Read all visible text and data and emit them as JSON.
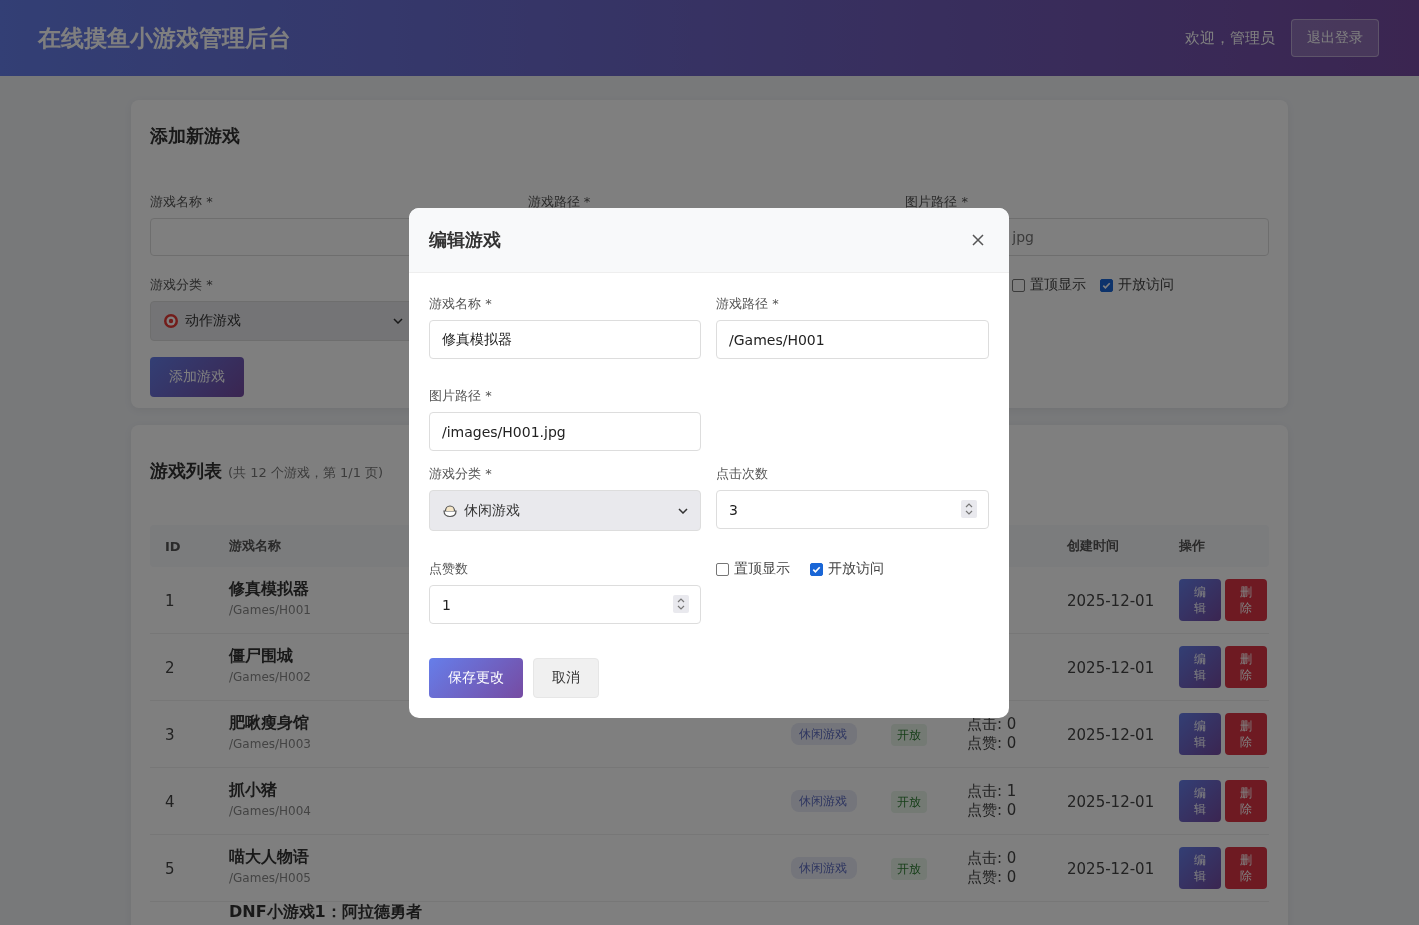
{
  "header": {
    "title": "在线摸鱼小游戏管理后台",
    "welcome": "欢迎，管理员",
    "logout": "退出登录"
  },
  "add_form": {
    "title": "添加新游戏",
    "fields": [
      {
        "label": "游戏名称 *",
        "input": true
      },
      {
        "label": "游戏路径 *",
        "input": false
      },
      {
        "label": "图片路径 *",
        "input": true,
        "placeholder": "jpg"
      }
    ],
    "category": {
      "label": "游戏分类 *",
      "value": "动作游戏"
    },
    "checkboxes": [
      {
        "label": "置顶显示",
        "checked": false
      },
      {
        "label": "开放访问",
        "checked": true
      }
    ],
    "submit": "添加游戏"
  },
  "game_list": {
    "title": "游戏列表",
    "summary": "(共 12 个游戏，第 1/1 页)",
    "columns": [
      "ID",
      "游戏名称",
      "创建时间",
      "操作"
    ],
    "rows": [
      {
        "id": "1",
        "name": "修真模拟器",
        "path": "/Games/H001",
        "created": "2025-12-01",
        "actions": [
          "编辑",
          "删除"
        ]
      },
      {
        "id": "2",
        "name": "僵尸围城",
        "path": "/Games/H002",
        "created": "2025-12-01",
        "actions": [
          "编辑",
          "删除"
        ]
      },
      {
        "id": "3",
        "name": "肥啾瘦身馆",
        "path": "/Games/H003",
        "category": "休闲游戏",
        "status": "开放",
        "clicks": "点击: 0",
        "likes": "点赞: 0",
        "created": "2025-12-01",
        "actions": [
          "编辑",
          "删除"
        ]
      },
      {
        "id": "4",
        "name": "抓小猪",
        "path": "/Games/H004",
        "category": "休闲游戏",
        "status": "开放",
        "clicks": "点击: 1",
        "likes": "点赞: 0",
        "created": "2025-12-01",
        "actions": [
          "编辑",
          "删除"
        ]
      },
      {
        "id": "5",
        "name": "喵大人物语",
        "path": "/Games/H005",
        "category": "休闲游戏",
        "status": "开放",
        "clicks": "点击: 0",
        "likes": "点赞: 0",
        "created": "2025-12-01",
        "actions": [
          "编辑",
          "删除"
        ]
      },
      {
        "name": "DNF小游戏1：阿拉德勇者"
      }
    ]
  },
  "modal": {
    "title": "编辑游戏",
    "name": {
      "label": "游戏名称 *",
      "value": "修真模拟器"
    },
    "path": {
      "label": "游戏路径 *",
      "value": "/Games/H001"
    },
    "image": {
      "label": "图片路径 *",
      "value": "/images/H001.jpg"
    },
    "category": {
      "label": "游戏分类 *",
      "value": "休闲游戏"
    },
    "clicks": {
      "label": "点击次数",
      "value": "3"
    },
    "likes": {
      "label": "点赞数",
      "value": "1"
    },
    "checkboxes": [
      {
        "label": "置顶显示",
        "checked": false
      },
      {
        "label": "开放访问",
        "checked": true
      }
    ],
    "save": "保存更改",
    "cancel": "取消"
  }
}
